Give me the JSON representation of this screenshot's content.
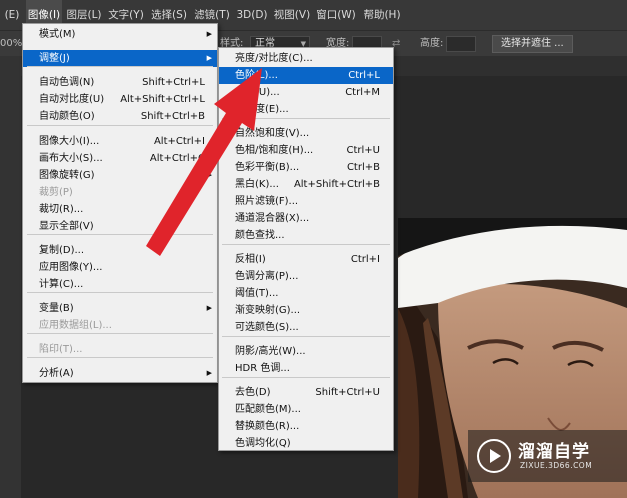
{
  "menubar": {
    "items": [
      "(E)",
      "图像(I)",
      "图层(L)",
      "文字(Y)",
      "选择(S)",
      "滤镜(T)",
      "3D(D)",
      "视图(V)",
      "窗口(W)",
      "帮助(H)"
    ]
  },
  "options_bar": {
    "zoom_fragment": "00%",
    "style_label": "样式:",
    "style_value": "正常",
    "width_label": "宽度:",
    "height_label": "高度:",
    "select_mask_button": "选择并遮住 ..."
  },
  "image_menu": {
    "items": [
      {
        "label": "模式(M)",
        "shortcut": "",
        "submenu": true,
        "disabled": false,
        "highlighted": false
      },
      {
        "label": "调整(J)",
        "shortcut": "",
        "submenu": true,
        "disabled": false,
        "highlighted": true
      },
      {
        "label": "自动色调(N)",
        "shortcut": "Shift+Ctrl+L",
        "submenu": false,
        "disabled": false,
        "highlighted": false
      },
      {
        "label": "自动对比度(U)",
        "shortcut": "Alt+Shift+Ctrl+L",
        "submenu": false,
        "disabled": false,
        "highlighted": false
      },
      {
        "label": "自动颜色(O)",
        "shortcut": "Shift+Ctrl+B",
        "submenu": false,
        "disabled": false,
        "highlighted": false
      },
      {
        "label": "图像大小(I)...",
        "shortcut": "Alt+Ctrl+I",
        "submenu": false,
        "disabled": false,
        "highlighted": false
      },
      {
        "label": "画布大小(S)...",
        "shortcut": "Alt+Ctrl+C",
        "submenu": false,
        "disabled": false,
        "highlighted": false
      },
      {
        "label": "图像旋转(G)",
        "shortcut": "",
        "submenu": true,
        "disabled": false,
        "highlighted": false
      },
      {
        "label": "裁剪(P)",
        "shortcut": "",
        "submenu": false,
        "disabled": true,
        "highlighted": false
      },
      {
        "label": "裁切(R)...",
        "shortcut": "",
        "submenu": false,
        "disabled": false,
        "highlighted": false
      },
      {
        "label": "显示全部(V)",
        "shortcut": "",
        "submenu": false,
        "disabled": false,
        "highlighted": false
      },
      {
        "label": "复制(D)...",
        "shortcut": "",
        "submenu": false,
        "disabled": false,
        "highlighted": false
      },
      {
        "label": "应用图像(Y)...",
        "shortcut": "",
        "submenu": false,
        "disabled": false,
        "highlighted": false
      },
      {
        "label": "计算(C)...",
        "shortcut": "",
        "submenu": false,
        "disabled": false,
        "highlighted": false
      },
      {
        "label": "变量(B)",
        "shortcut": "",
        "submenu": true,
        "disabled": false,
        "highlighted": false
      },
      {
        "label": "应用数据组(L)...",
        "shortcut": "",
        "submenu": false,
        "disabled": true,
        "highlighted": false
      },
      {
        "label": "陷印(T)...",
        "shortcut": "",
        "submenu": false,
        "disabled": true,
        "highlighted": false
      },
      {
        "label": "分析(A)",
        "shortcut": "",
        "submenu": true,
        "disabled": false,
        "highlighted": false
      }
    ]
  },
  "adjust_menu": {
    "items": [
      {
        "label": "亮度/对比度(C)...",
        "shortcut": "",
        "highlighted": false
      },
      {
        "label": "色阶(L)...",
        "shortcut": "Ctrl+L",
        "highlighted": true
      },
      {
        "label": "曲线(U)...",
        "shortcut": "Ctrl+M",
        "highlighted": false
      },
      {
        "label": "曝光度(E)...",
        "shortcut": "",
        "highlighted": false
      },
      {
        "label": "自然饱和度(V)...",
        "shortcut": "",
        "highlighted": false
      },
      {
        "label": "色相/饱和度(H)...",
        "shortcut": "Ctrl+U",
        "highlighted": false
      },
      {
        "label": "色彩平衡(B)...",
        "shortcut": "Ctrl+B",
        "highlighted": false
      },
      {
        "label": "黑白(K)...",
        "shortcut": "Alt+Shift+Ctrl+B",
        "highlighted": false
      },
      {
        "label": "照片滤镜(F)...",
        "shortcut": "",
        "highlighted": false
      },
      {
        "label": "通道混合器(X)...",
        "shortcut": "",
        "highlighted": false
      },
      {
        "label": "颜色查找...",
        "shortcut": "",
        "highlighted": false
      },
      {
        "label": "反相(I)",
        "shortcut": "Ctrl+I",
        "highlighted": false
      },
      {
        "label": "色调分离(P)...",
        "shortcut": "",
        "highlighted": false
      },
      {
        "label": "阈值(T)...",
        "shortcut": "",
        "highlighted": false
      },
      {
        "label": "渐变映射(G)...",
        "shortcut": "",
        "highlighted": false
      },
      {
        "label": "可选颜色(S)...",
        "shortcut": "",
        "highlighted": false
      },
      {
        "label": "阴影/高光(W)...",
        "shortcut": "",
        "highlighted": false
      },
      {
        "label": "HDR 色调...",
        "shortcut": "",
        "highlighted": false
      },
      {
        "label": "去色(D)",
        "shortcut": "Shift+Ctrl+U",
        "highlighted": false
      },
      {
        "label": "匹配颜色(M)...",
        "shortcut": "",
        "highlighted": false
      },
      {
        "label": "替换颜色(R)...",
        "shortcut": "",
        "highlighted": false
      },
      {
        "label": "色调均化(Q)",
        "shortcut": "",
        "highlighted": false
      }
    ]
  },
  "watermark": {
    "title": "溜溜自学",
    "url": "ZIXUE.3D66.COM"
  },
  "colors": {
    "highlight": "#0a66c8",
    "arrow": "#e0242b",
    "menubar": "#383838"
  }
}
